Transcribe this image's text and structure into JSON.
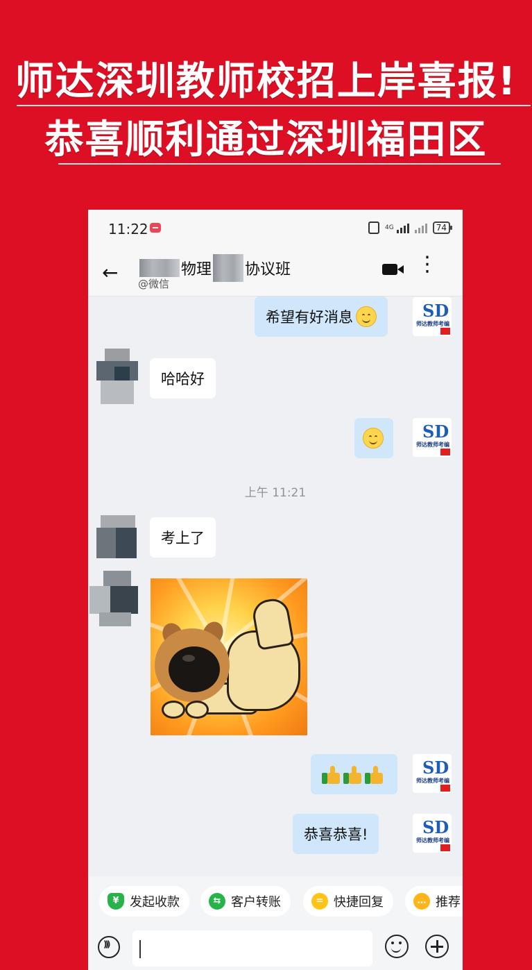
{
  "banner": {
    "line1": "师达深圳教师校招上岸喜报!",
    "line2": "恭喜顺利通过深圳福田区"
  },
  "status_bar": {
    "time": "11:22",
    "network": "4G",
    "battery": "74"
  },
  "chat_header": {
    "title_part1": "物理",
    "title_part2": "协议班",
    "subtitle": "@微信"
  },
  "messages": [
    {
      "sender": "me",
      "text": "希望有好消息",
      "emoji": "smile"
    },
    {
      "sender": "them",
      "text": "哈哈好"
    },
    {
      "sender": "me",
      "text": "",
      "emoji": "smile"
    },
    {
      "sender": "them",
      "text": "考上了"
    },
    {
      "sender": "them",
      "type": "sticker",
      "sticker": "dog-thumbs-up"
    },
    {
      "sender": "me",
      "text": "",
      "emoji": "thumbs-up x3"
    },
    {
      "sender": "me",
      "text": "恭喜恭喜!"
    }
  ],
  "time_separator": "上午 11:21",
  "avatar_me": {
    "logo_letter": "SD",
    "logo_text": "师达教师考编"
  },
  "quick_actions": [
    {
      "label": "发起收款",
      "icon": "yuan-shield-icon"
    },
    {
      "label": "客户转账",
      "icon": "transfer-icon"
    },
    {
      "label": "快捷回复",
      "icon": "quick-reply-icon"
    },
    {
      "label": "推荐",
      "icon": "recommend-icon"
    }
  ],
  "colors": {
    "background": "#dc0f24",
    "my_bubble": "#cfe6fb",
    "their_bubble": "#ffffff"
  }
}
